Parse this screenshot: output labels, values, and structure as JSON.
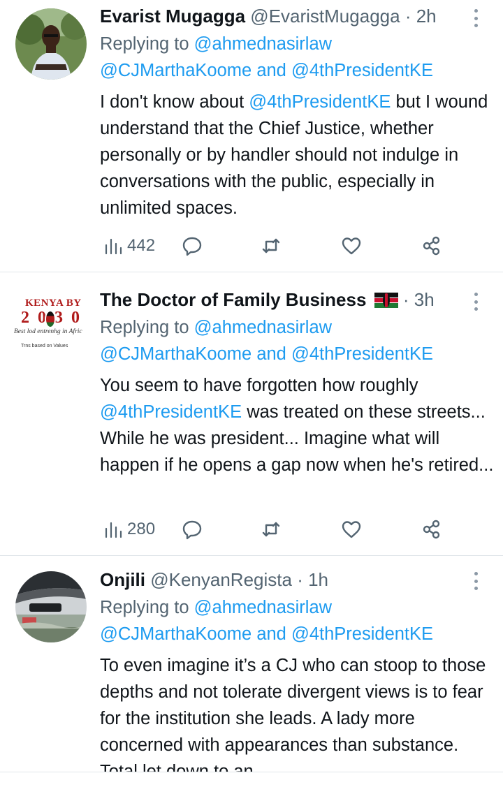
{
  "tweets": [
    {
      "name": "Evarist Mugagga",
      "handle": "@EvaristMugagga",
      "time": "· 2h",
      "replying_label": "Replying to",
      "reply_to_1": "@ahmednasirlaw",
      "reply_to_2": "@CJMarthaKoome",
      "reply_and": "and",
      "reply_to_3": "@4thPresidentKE",
      "body_pre": "I don't know about",
      "body_mention": "@4thPresidentKE",
      "body_post": "but I wound understand that the Chief Justice, whether personally or by handler should not indulge in conversations with the public, especially in unlimited spaces.",
      "views": "442"
    },
    {
      "name": "The Doctor of Family Business",
      "flag": "🇰🇪",
      "time": "· 3h",
      "replying_label": "Replying to",
      "reply_to_1": "@ahmednasirlaw",
      "reply_to_2": "@CJMarthaKoome",
      "reply_and": "and",
      "reply_to_3": "@4thPresidentKE",
      "body_pre": "You seem to have forgotten how roughly",
      "body_mention": "@4thPresidentKE",
      "body_post": "was treated on these streets... While he was president... Imagine what will happen if he opens a gap now when he's retired...",
      "views": "280",
      "avatar_text": {
        "line1": "KENYA BY",
        "line2": "2030",
        "line3": "Best lod entrenhg in Afric",
        "line4": "Trns based on Values"
      }
    },
    {
      "name": "Onjili",
      "handle": "@KenyanRegista",
      "time": "· 1h",
      "replying_label": "Replying to",
      "reply_to_1": "@ahmednasirlaw",
      "reply_to_2": "@CJMarthaKoome",
      "reply_and": "and",
      "reply_to_3": "@4thPresidentKE",
      "body": "To even imagine it’s a CJ who can stoop to those depths and not tolerate divergent views is to fear for the institution she leads. A lady more concerned with appearances than substance. Total let down to an"
    }
  ],
  "icons": {
    "views": "views-chart-icon",
    "reply": "reply-bubble-icon",
    "retweet": "retweet-icon",
    "like": "heart-icon",
    "share": "share-icon",
    "more": "more-vertical-icon"
  },
  "colors": {
    "accent": "#1d9bf0",
    "muted": "#536471",
    "text": "#0f1419"
  }
}
